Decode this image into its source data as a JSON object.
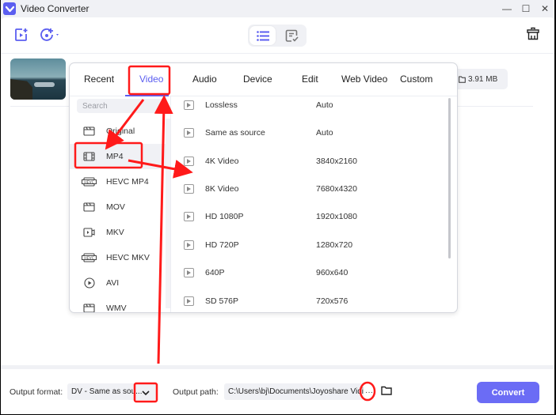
{
  "window": {
    "title": "Video Converter",
    "controls": {
      "minimize": "—",
      "maximize": "☐",
      "close": "✕"
    }
  },
  "toolbar": {
    "add_video_icon": "add-video-icon",
    "add_disc_icon": "add-disc-icon",
    "view_list_icon": "list-view-icon",
    "view_task_icon": "task-list-icon",
    "delete_icon": "trash-icon"
  },
  "file": {
    "size": "3.91 MB"
  },
  "popup": {
    "tabs": [
      "Recent",
      "Video",
      "Audio",
      "Device",
      "Edit",
      "Web Video",
      "Custom"
    ],
    "active_tab": "Video",
    "search_placeholder": "Search",
    "formats": [
      {
        "label": "Original",
        "icon": "clapper-icon"
      },
      {
        "label": "MP4",
        "icon": "film-icon",
        "selected": true
      },
      {
        "label": "HEVC MP4",
        "icon": "hevc-icon"
      },
      {
        "label": "MOV",
        "icon": "clapper-icon"
      },
      {
        "label": "MKV",
        "icon": "video-camera-icon"
      },
      {
        "label": "HEVC MKV",
        "icon": "hevc-icon"
      },
      {
        "label": "AVI",
        "icon": "play-circle-icon"
      },
      {
        "label": "WMV",
        "icon": "clapper-icon"
      }
    ],
    "presets": [
      {
        "name": "Lossless",
        "resolution": "Auto"
      },
      {
        "name": "Same as source",
        "resolution": "Auto"
      },
      {
        "name": "4K Video",
        "resolution": "3840x2160"
      },
      {
        "name": "8K Video",
        "resolution": "7680x4320"
      },
      {
        "name": "HD 1080P",
        "resolution": "1920x1080"
      },
      {
        "name": "HD 720P",
        "resolution": "1280x720"
      },
      {
        "name": "640P",
        "resolution": "960x640"
      },
      {
        "name": "SD 576P",
        "resolution": "720x576"
      }
    ]
  },
  "bottom": {
    "output_format_label": "Output format:",
    "output_format_value": "DV - Same as sou...",
    "output_path_label": "Output path:",
    "output_path_value": "C:\\Users\\bj\\Documents\\Joyoshare VidiK",
    "more_label": "···",
    "convert_label": "Convert"
  },
  "colors": {
    "accent": "#5b5ef0",
    "convert_button": "#6b6cf5",
    "annotation": "#ff1a1a"
  }
}
